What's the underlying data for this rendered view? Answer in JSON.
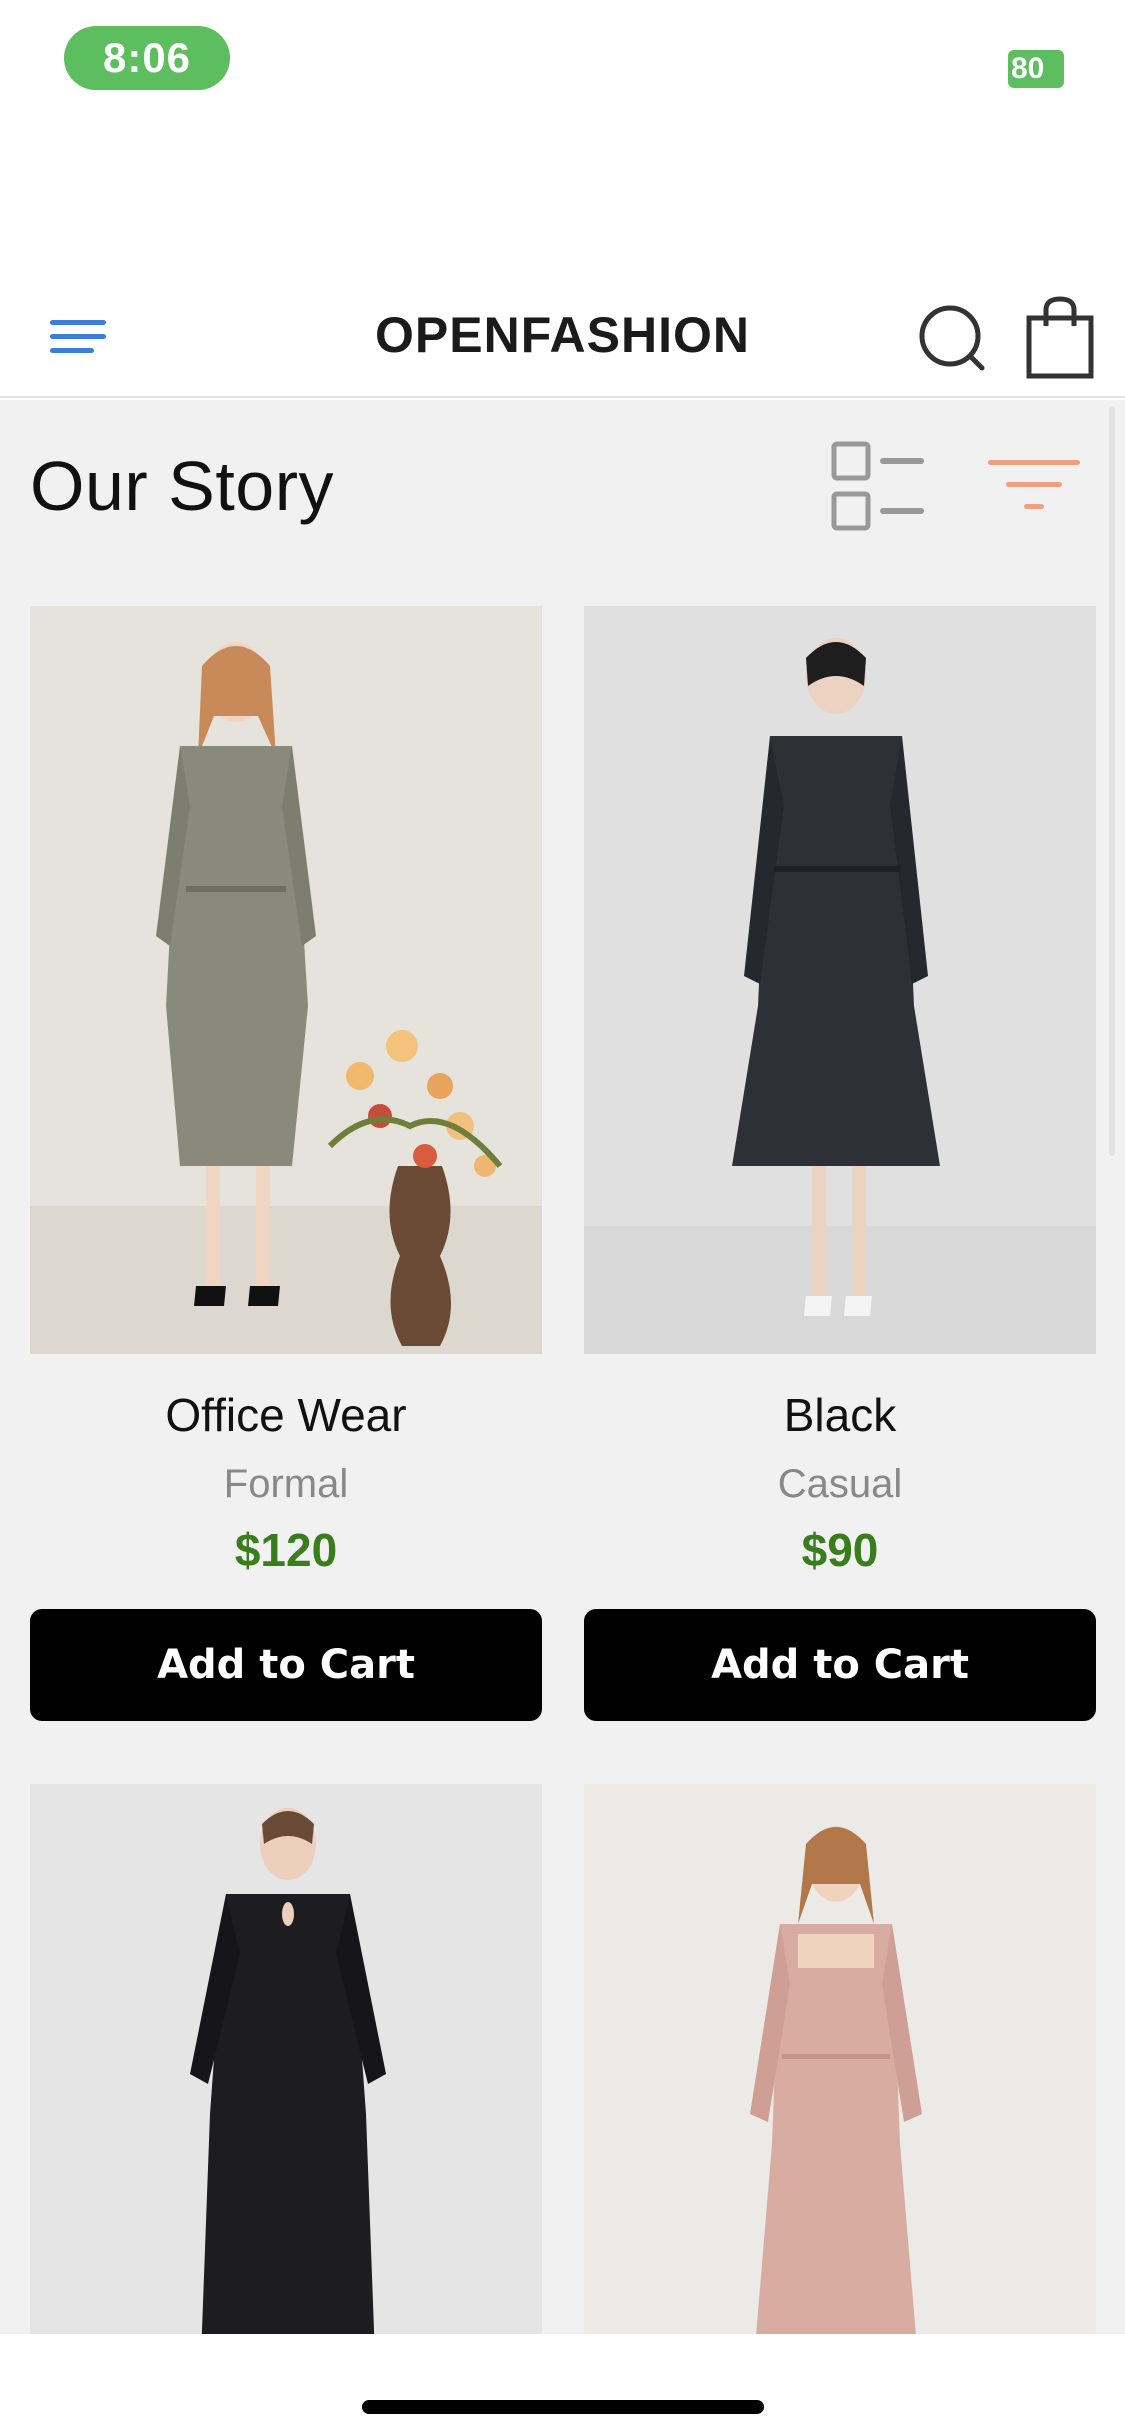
{
  "status_bar": {
    "time": "8:06",
    "battery": "80",
    "accent_color": "#5cbe5e"
  },
  "header": {
    "brand": "OPENFASHION",
    "menu_icon": "hamburger-menu-icon",
    "search_icon": "search-icon",
    "bag_icon": "shopping-bag-icon"
  },
  "page": {
    "title": "Our Story",
    "view_icon": "list-view-icon",
    "filter_icon": "filter-icon"
  },
  "products": [
    {
      "name": "Office Wear",
      "category": "Formal",
      "price": "$120",
      "button": "Add to Cart",
      "image": "woman in grey coat dress with flowers"
    },
    {
      "name": "Black",
      "category": "Casual",
      "price": "$90",
      "button": "Add to Cart",
      "image": "woman in black tweed coat dress"
    },
    {
      "image": "woman in black keyhole dress"
    },
    {
      "image": "woman in pink square-neck dress"
    }
  ],
  "colors": {
    "price": "#3a7d1c",
    "button_bg": "#000000",
    "menu_icon": "#3b7ddd",
    "filter_icon": "#f0a081"
  }
}
